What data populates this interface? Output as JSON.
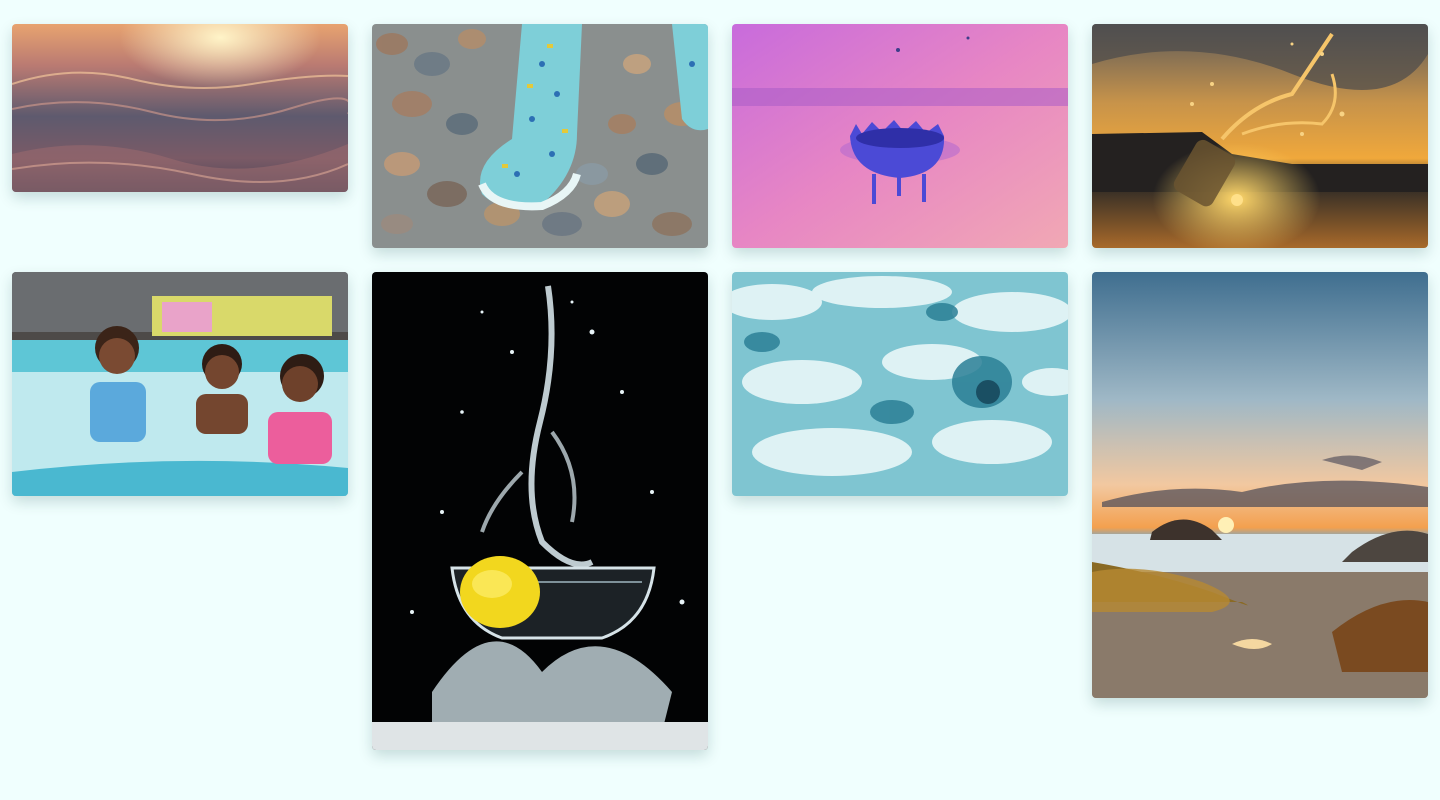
{
  "gallery": {
    "photos": [
      {
        "subject": "ocean-wave-sunset"
      },
      {
        "subject": "rain-boots-on-pebbles"
      },
      {
        "subject": "water-drop-crown-pink"
      },
      {
        "subject": "bottle-splash-sunset"
      },
      {
        "subject": "children-in-pool"
      },
      {
        "subject": "lemon-water-splash"
      },
      {
        "subject": "sea-foam-surf"
      },
      {
        "subject": "beach-sunset-rocks"
      }
    ]
  }
}
